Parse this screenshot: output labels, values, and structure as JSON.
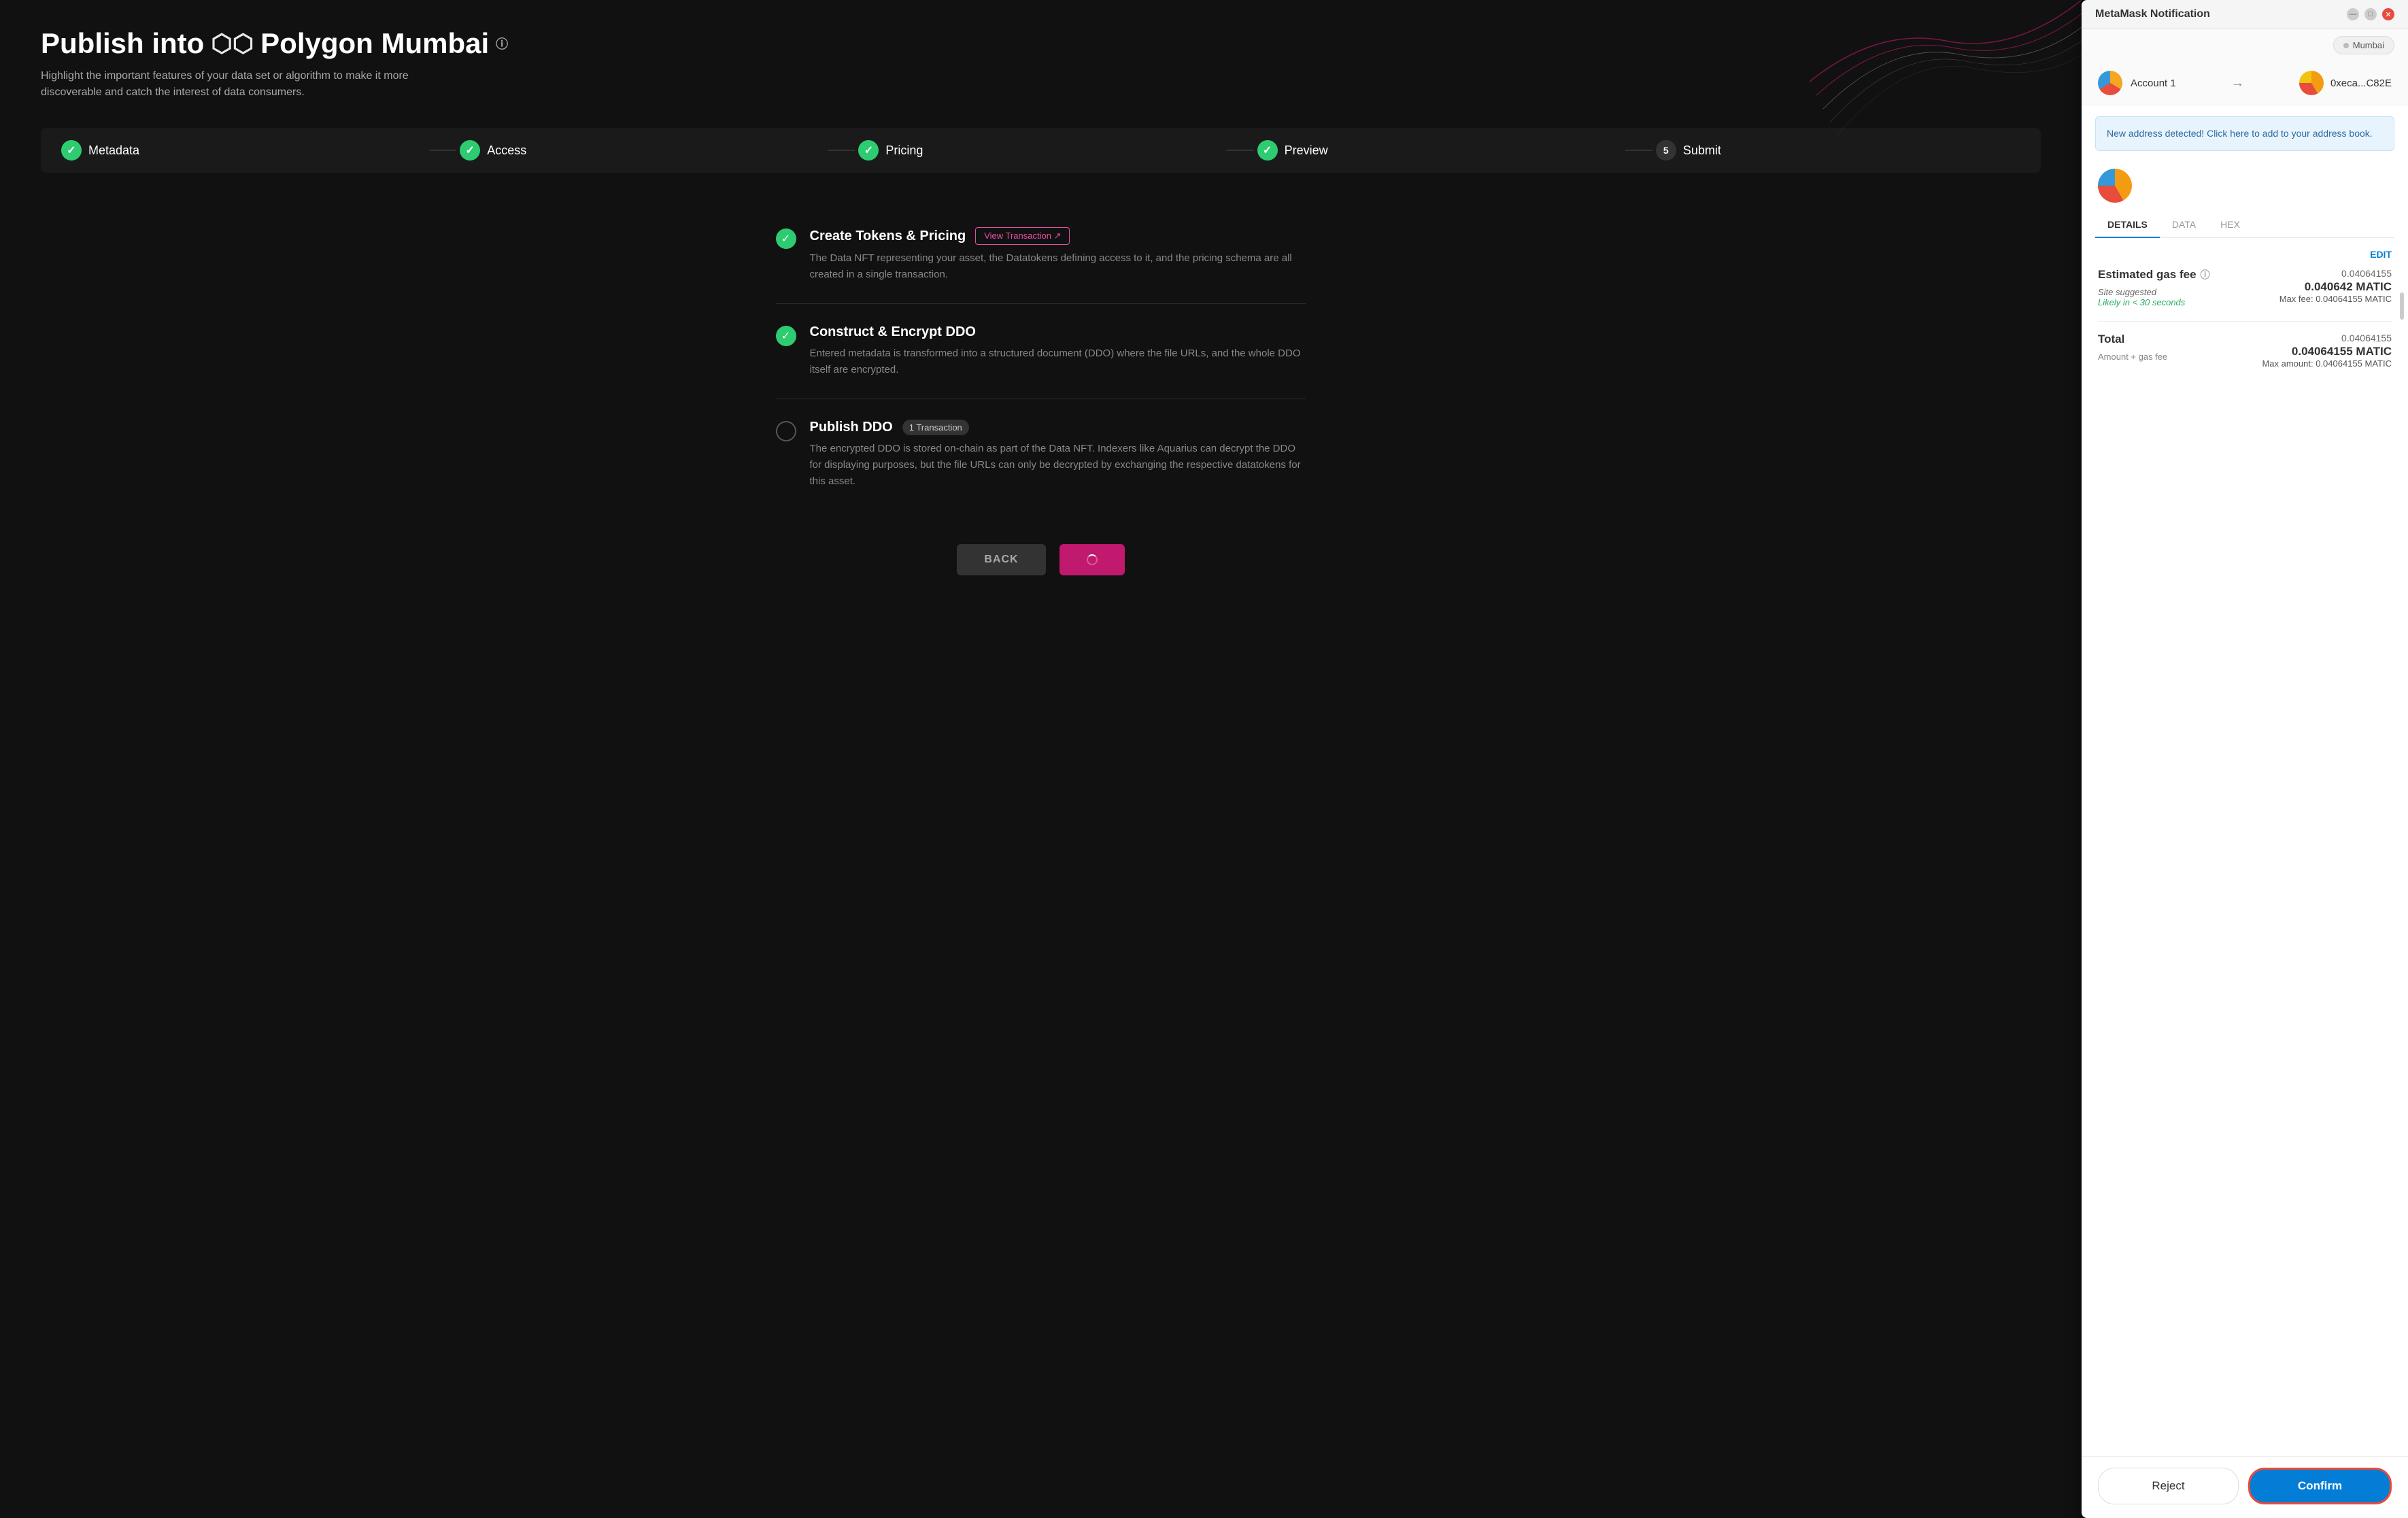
{
  "main": {
    "title_start": "Publish into ",
    "title_icon": "⬡⬡",
    "title_end": "Polygon Mumbai",
    "subtitle": "Highlight the important features of your data set or algorithm to make it more discoverable and catch the interest of data consumers.",
    "steps": [
      {
        "id": "metadata",
        "label": "Metadata",
        "state": "done",
        "number": null
      },
      {
        "id": "access",
        "label": "Access",
        "state": "done",
        "number": null
      },
      {
        "id": "pricing",
        "label": "Pricing",
        "state": "done",
        "number": null
      },
      {
        "id": "preview",
        "label": "Preview",
        "state": "done",
        "number": null
      },
      {
        "id": "submit",
        "label": "Submit",
        "state": "numbered",
        "number": "5"
      }
    ],
    "sections": [
      {
        "id": "create-tokens",
        "title": "Create Tokens & Pricing",
        "state": "done",
        "badge": null,
        "view_tx_label": "View Transaction ↗",
        "desc": "The Data NFT representing your asset, the Datatokens defining access to it, and the pricing schema are all created in a single transaction."
      },
      {
        "id": "construct-ddo",
        "title": "Construct & Encrypt DDO",
        "state": "done",
        "badge": null,
        "view_tx_label": null,
        "desc": "Entered metadata is transformed into a structured document (DDO) where the file URLs, and the whole DDO itself are encrypted."
      },
      {
        "id": "publish-ddo",
        "title": "Publish DDO",
        "state": "pending",
        "badge": "1 Transaction",
        "view_tx_label": null,
        "desc": "The encrypted DDO is stored on-chain as part of the Data NFT. Indexers like Aquarius can decrypt the DDO for displaying purposes, but the file URLs can only be decrypted by exchanging the respective datatokens for this asset."
      }
    ],
    "btn_back": "BACK",
    "btn_next_spinning": true
  },
  "metamask": {
    "title": "MetaMask Notification",
    "win_btns": {
      "minimize": "—",
      "maximize": "□",
      "close": "✕"
    },
    "network": "Mumbai",
    "account_from": "Account 1",
    "account_to": "0xeca...C82E",
    "notice": "New address detected! Click here to add to your address book.",
    "tabs": [
      "DETAILS",
      "DATA",
      "HEX"
    ],
    "active_tab": "DETAILS",
    "edit_label": "EDIT",
    "estimated_gas_fee": {
      "label": "Estimated gas fee",
      "small_value": "0.04064155",
      "main_value": "0.040642 MATIC",
      "site_suggested": "Site suggested",
      "likely": "Likely in < 30 seconds",
      "max_fee_label": "Max fee:",
      "max_fee_value": "0.04064155 MATIC"
    },
    "total": {
      "label": "Total",
      "small_value": "0.04064155",
      "main_value": "0.04064155 MATIC",
      "sub_label": "Amount + gas fee",
      "max_label": "Max amount:",
      "max_value": "0.04064155 MATIC"
    },
    "reject_label": "Reject",
    "confirm_label": "Confirm"
  }
}
